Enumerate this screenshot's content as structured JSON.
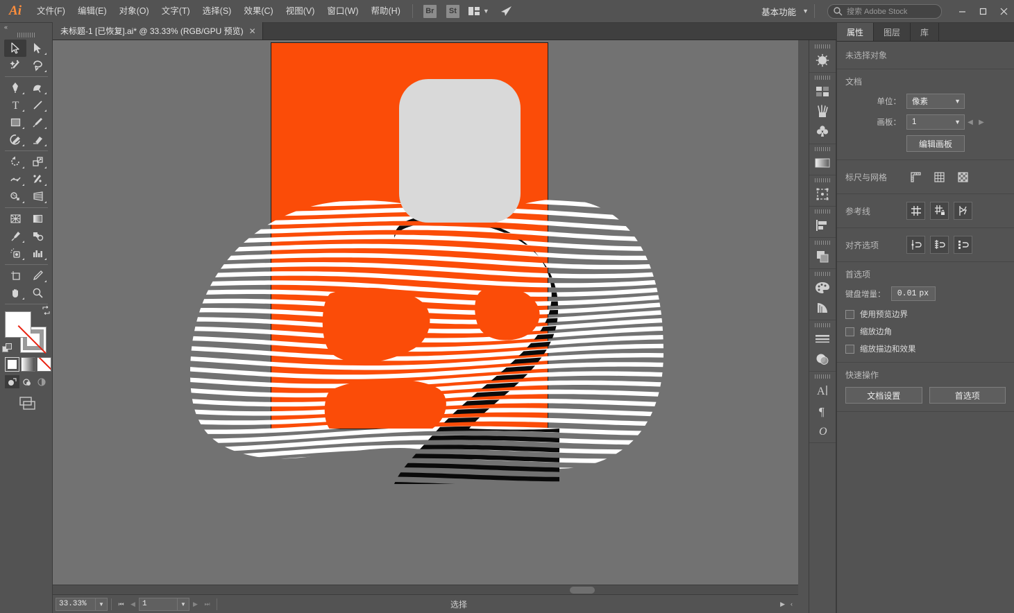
{
  "app": {
    "logo": "Ai",
    "menus": [
      "文件(F)",
      "编辑(E)",
      "对象(O)",
      "文字(T)",
      "选择(S)",
      "效果(C)",
      "视图(V)",
      "窗口(W)",
      "帮助(H)"
    ],
    "bridge_label": "Br",
    "stock_label": "St",
    "workspace": "基本功能",
    "search_placeholder": "搜索 Adobe Stock",
    "window_buttons": {
      "minimize": "—",
      "maximize": "☐",
      "close": "✕"
    }
  },
  "tab": {
    "title": "未标题-1 [已恢复].ai* @ 33.33% (RGB/GPU 预览)",
    "close": "✕"
  },
  "tools": {
    "collapse": "«",
    "items": [
      {
        "name": "selection-tool",
        "active": true
      },
      {
        "name": "direct-selection-tool",
        "active": false
      },
      {
        "name": "magic-wand-tool",
        "active": false
      },
      {
        "name": "lasso-tool",
        "active": false
      },
      {
        "name": "pen-tool",
        "active": false
      },
      {
        "name": "curvature-tool",
        "active": false
      },
      {
        "name": "type-tool",
        "active": false
      },
      {
        "name": "line-segment-tool",
        "active": false
      },
      {
        "name": "rectangle-tool",
        "active": false
      },
      {
        "name": "paintbrush-tool",
        "active": false
      },
      {
        "name": "shaper-tool",
        "active": false
      },
      {
        "name": "eraser-tool",
        "active": false
      },
      {
        "name": "rotate-tool",
        "active": false
      },
      {
        "name": "scale-tool",
        "active": false
      },
      {
        "name": "width-tool",
        "active": false
      },
      {
        "name": "free-transform-tool",
        "active": false
      },
      {
        "name": "shape-builder-tool",
        "active": false
      },
      {
        "name": "perspective-grid-tool",
        "active": false
      },
      {
        "name": "mesh-tool",
        "active": false
      },
      {
        "name": "gradient-tool",
        "active": false
      },
      {
        "name": "eyedropper-tool",
        "active": false
      },
      {
        "name": "blend-tool",
        "active": false
      },
      {
        "name": "symbol-sprayer-tool",
        "active": false
      },
      {
        "name": "column-graph-tool",
        "active": false
      },
      {
        "name": "artboard-tool",
        "active": false
      },
      {
        "name": "slice-tool",
        "active": false
      },
      {
        "name": "hand-tool",
        "active": false
      },
      {
        "name": "zoom-tool",
        "active": false
      }
    ],
    "fill_color": "#ffffff",
    "stroke_color": "none",
    "none_slash_color": "#e8200f",
    "swatches": [
      "color-swatch",
      "gradient-swatch",
      "none-swatch"
    ],
    "draw_modes": [
      "draw-normal",
      "draw-behind",
      "draw-inside"
    ],
    "screen_mode": "change-screen-mode"
  },
  "canvas": {
    "artboard_color": "#FB4C08",
    "rounded_rect_color": "#D9D9D9",
    "stripe_black": "#0a0a0a",
    "stripe_white": "#ffffff",
    "background": "#727272"
  },
  "statusbar": {
    "zoom": "33.33%",
    "page": "1",
    "tool_status": "选择",
    "nav_first": "❘◀",
    "nav_prev": "◀",
    "nav_next": "▶",
    "nav_last": "▶❘",
    "play": "▶",
    "collapse": "‹"
  },
  "rail": {
    "items": [
      "properties-panel-icon",
      "swatches-panel-icon",
      "brushes-panel-icon",
      "symbols-panel-icon",
      "gradient-panel-icon",
      "transform-panel-icon",
      "align-panel-icon",
      "pathfinder-panel-icon",
      "color-panel-icon",
      "color-guide-panel-icon",
      "stroke-panel-icon",
      "transparency-panel-icon",
      "character-panel-icon",
      "paragraph-panel-icon",
      "glyphs-panel-icon"
    ]
  },
  "properties": {
    "tabs": [
      {
        "label": "属性",
        "active": true
      },
      {
        "label": "图层",
        "active": false
      },
      {
        "label": "库",
        "active": false
      }
    ],
    "no_selection": "未选择对象",
    "document": {
      "title": "文档",
      "units_label": "单位：",
      "units_value": "像素",
      "artboard_label": "画板：",
      "artboard_value": "1",
      "edit_artboards": "编辑画板"
    },
    "rulers_grid": {
      "title": "标尺与网格",
      "icons": [
        "show-rulers-icon",
        "show-grid-icon",
        "show-transparency-grid-icon"
      ]
    },
    "guides": {
      "title": "参考线",
      "icons": [
        "show-guides-icon",
        "lock-guides-icon",
        "smart-guides-icon"
      ]
    },
    "align_options": {
      "title": "对齐选项",
      "icons": [
        "snap-to-point-icon",
        "snap-to-grid-icon",
        "snap-to-pixel-icon"
      ]
    },
    "preferences": {
      "title": "首选项",
      "keyboard_increment_label": "键盘增量：",
      "keyboard_increment_value": "0.01",
      "keyboard_increment_unit": "px",
      "checkboxes": [
        {
          "label": "使用预览边界",
          "checked": false
        },
        {
          "label": "缩放边角",
          "checked": false
        },
        {
          "label": "缩放描边和效果",
          "checked": false
        }
      ]
    },
    "quick_actions": {
      "title": "快速操作",
      "buttons": [
        "文档设置",
        "首选项"
      ]
    },
    "dock_expand": "»"
  }
}
